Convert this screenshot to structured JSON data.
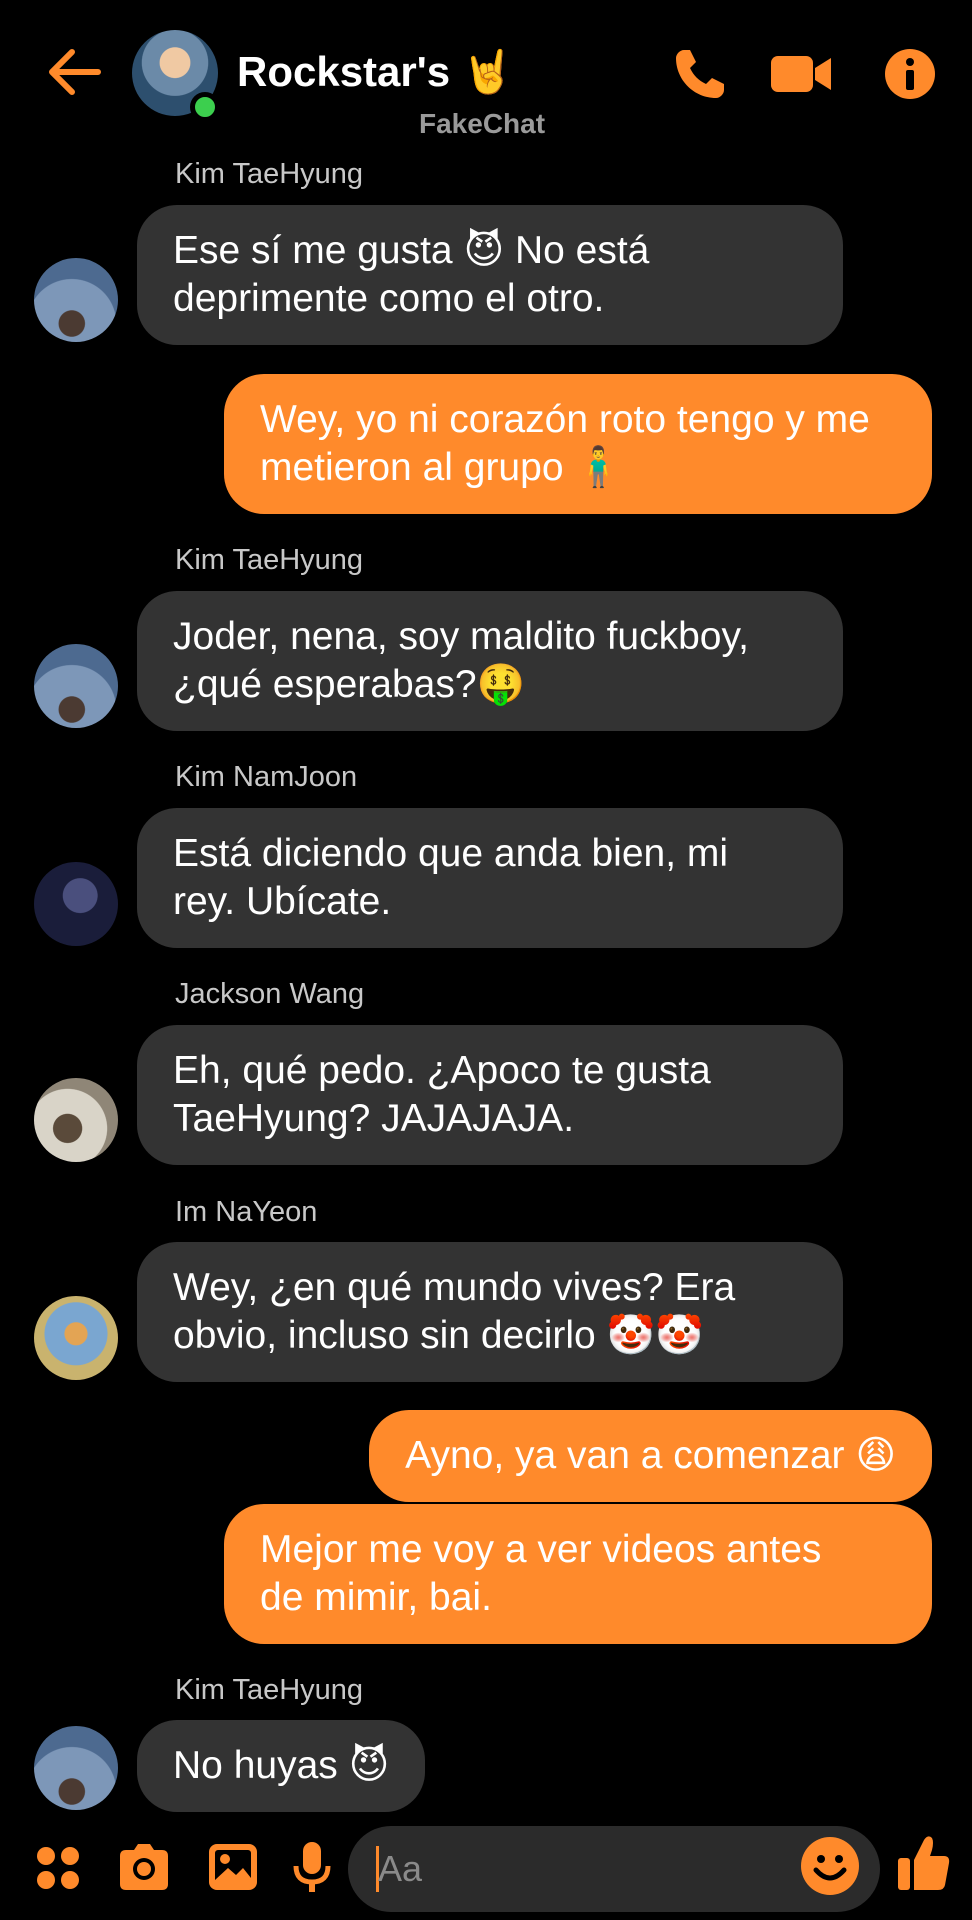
{
  "header": {
    "title": "Rockstar's 🤘",
    "subtitle": "FakeChat"
  },
  "messages": [
    {
      "sender": "Kim TaeHyung",
      "text": "Ese sí me gusta 😈 No está deprimente como el otro.",
      "line1": "Ese sí me gusta 😈 No está",
      "line2": "deprimente como el otro."
    },
    {
      "sender": "",
      "text": "Wey, yo ni corazón roto tengo y me metieron al grupo 🧍‍♂️",
      "line1": "Wey, yo ni corazón roto tengo y me",
      "line2": "metieron al grupo 🧍‍♂️"
    },
    {
      "sender": "Kim TaeHyung",
      "text": "Joder, nena, soy maldito fuckboy, ¿qué esperabas?🤑",
      "line1": "Joder, nena, soy maldito fuckboy,",
      "line2": "¿qué esperabas?🤑"
    },
    {
      "sender": "Kim NamJoon",
      "text": "Está diciendo que anda bien, mi rey. Ubícate.",
      "line1": "Está diciendo que anda bien, mi",
      "line2": "rey. Ubícate."
    },
    {
      "sender": "Jackson Wang",
      "text": "Eh, qué pedo. ¿Apoco te gusta TaeHyung? JAJAJAJA.",
      "line1": "Eh, qué pedo. ¿Apoco te gusta",
      "line2": "TaeHyung? JAJAJAJA."
    },
    {
      "sender": "Im NaYeon",
      "text": "Wey, ¿en qué mundo vives? Era obvio, incluso sin decirlo 🤡🤡",
      "line1": "Wey, ¿en qué mundo vives? Era",
      "line2": "obvio, incluso sin decirlo 🤡🤡"
    },
    {
      "sender": "",
      "text": "Ayno, ya van a comenzar 😩",
      "line1": "Ayno, ya van a comenzar 😩"
    },
    {
      "sender": "",
      "text": "Mejor me voy a ver videos antes de mimir, bai.",
      "line1": "Mejor me voy a ver videos antes",
      "line2": "de mimir, bai."
    },
    {
      "sender": "Kim TaeHyung",
      "text": "No huyas 😈",
      "line1": "No huyas 😈"
    }
  ],
  "composer": {
    "placeholder": "Aa"
  },
  "icons": {
    "back": "back-arrow-icon",
    "phone": "phone-icon",
    "video": "video-camera-icon",
    "info": "info-icon",
    "apps": "apps-grid-icon",
    "camera": "camera-icon",
    "gallery": "gallery-icon",
    "mic": "microphone-icon",
    "emoji": "emoji-icon",
    "like": "thumbs-up-icon"
  },
  "colors": {
    "accent": "#ff8a2b",
    "incoming_bubble": "#333333",
    "background": "#000000"
  }
}
